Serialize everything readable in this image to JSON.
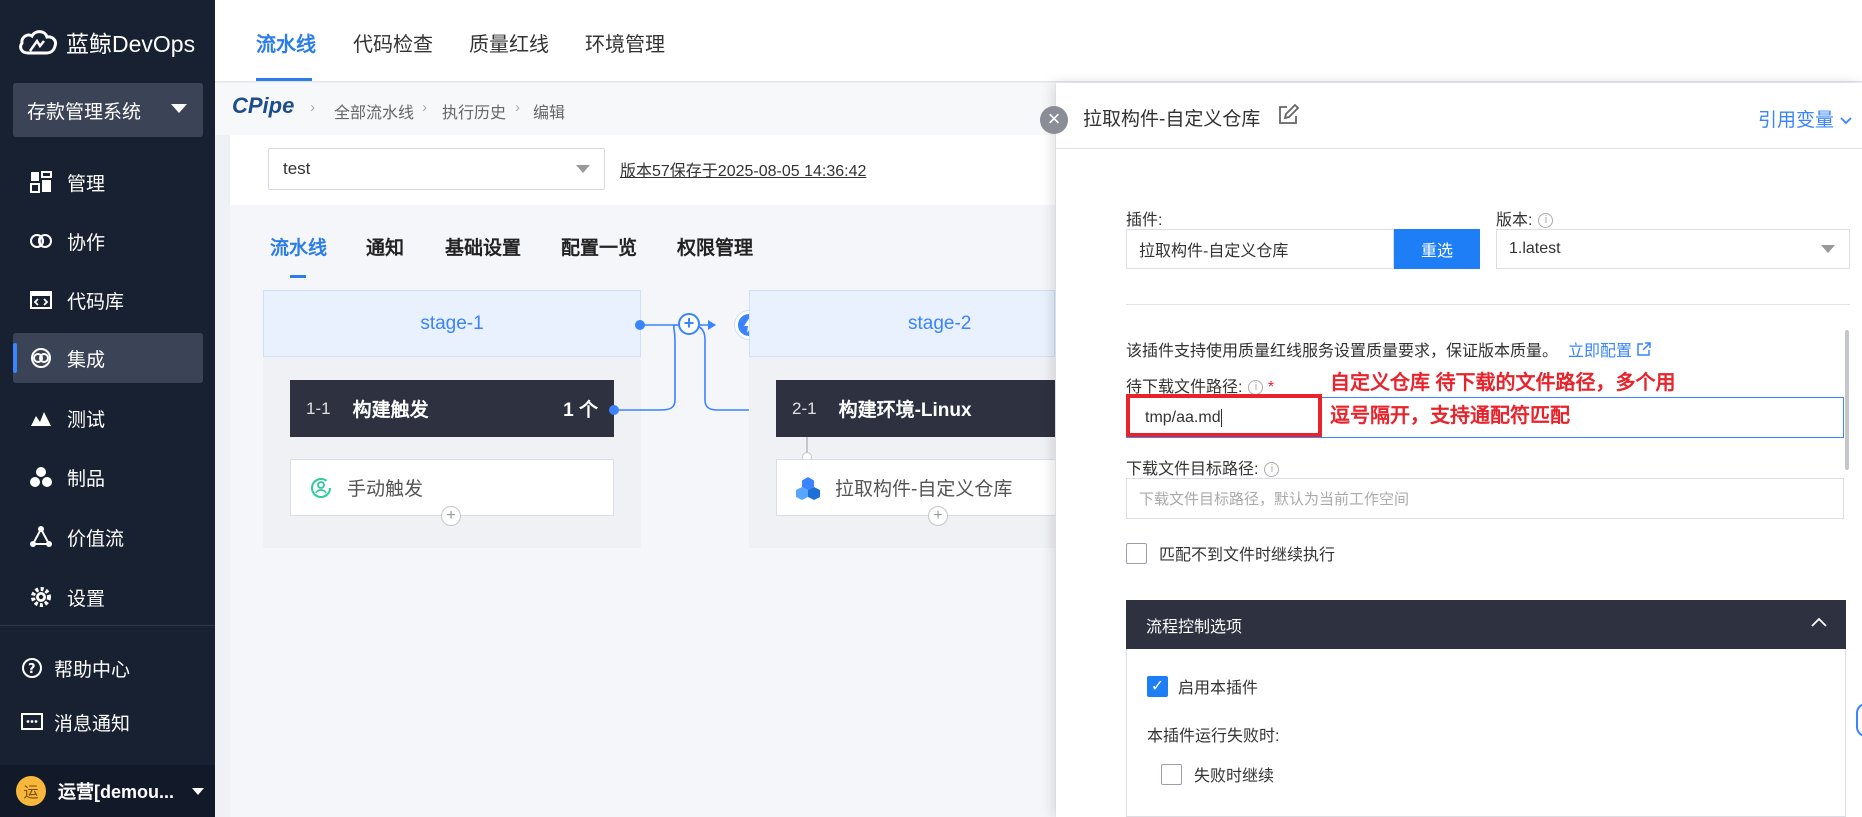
{
  "brand": {
    "name": "蓝鲸DevOps"
  },
  "project": {
    "name": "存款管理系统"
  },
  "sidebar": {
    "items": [
      {
        "label": "管理",
        "icon": "dashboard-icon"
      },
      {
        "label": "协作",
        "icon": "collaboration-icon"
      },
      {
        "label": "代码库",
        "icon": "code-repo-icon"
      },
      {
        "label": "集成",
        "icon": "integration-icon",
        "active": true
      },
      {
        "label": "测试",
        "icon": "test-icon"
      },
      {
        "label": "制品",
        "icon": "artifact-icon"
      },
      {
        "label": "价值流",
        "icon": "value-stream-icon"
      },
      {
        "label": "设置",
        "icon": "gear-icon"
      }
    ],
    "help": "帮助中心",
    "notify": "消息通知",
    "user": {
      "name": "运营[demou...",
      "avatar_char": "运"
    }
  },
  "topnav": {
    "tabs": [
      "流水线",
      "代码检查",
      "质量红线",
      "环境管理"
    ],
    "active": "流水线"
  },
  "breadcrumb": {
    "logo": "CPipe",
    "items": [
      "全部流水线",
      "执行历史",
      "编辑"
    ]
  },
  "pipeline": {
    "name": "test",
    "version_info": "版本57保存于2025-08-05 14:36:42",
    "tabs": [
      "流水线",
      "通知",
      "基础设置",
      "配置一览",
      "权限管理"
    ],
    "active_tab": "流水线",
    "stages": [
      {
        "name": "stage-1",
        "job": {
          "num": "1-1",
          "title": "构建触发",
          "count": "1 个"
        },
        "task": "手动触发"
      },
      {
        "name": "stage-2",
        "job": {
          "num": "2-1",
          "title": "构建环境-Linux"
        },
        "task": "拉取构件-自定义仓库"
      }
    ]
  },
  "panel": {
    "title": "拉取构件-自定义仓库",
    "ref_var": "引用变量",
    "plugin_label": "插件:",
    "plugin_value": "拉取构件-自定义仓库",
    "reselect": "重选",
    "version_label": "版本:",
    "version_value": "1.latest",
    "quality_tip": "该插件支持使用质量红线服务设置质量要求，保证版本质量。",
    "quality_link": "立即配置",
    "path_label": "待下载文件路径:",
    "path_value": "tmp/aa.md",
    "annotation_line1": "自定义仓库 待下载的文件路径，多个用",
    "annotation_line2": "逗号隔开，支持通配符匹配",
    "target_label": "下载文件目标路径:",
    "target_placeholder": "下载文件目标路径，默认为当前工作空间",
    "continue_nomatch": "匹配不到文件时继续执行",
    "flow_title": "流程控制选项",
    "enable_plugin": "启用本插件",
    "on_fail_label": "本插件运行失败时:",
    "fail_continue": "失败时继续"
  },
  "colors": {
    "accent": "#2b7de9",
    "sidebar_bg": "#182132",
    "annotation": "#e8232b"
  }
}
